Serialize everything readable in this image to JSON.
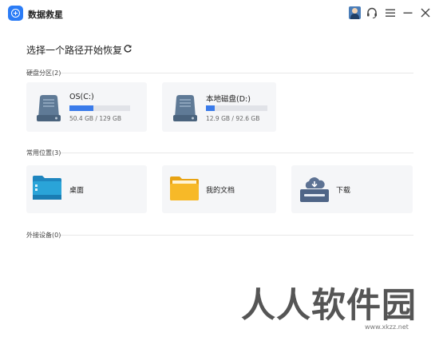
{
  "app": {
    "title": "数据救星"
  },
  "header": {
    "prompt": "选择一个路径开始恢复"
  },
  "groups": {
    "disks_label": "硬盘分区(2)",
    "common_label": "常用位置(3)",
    "external_label": "外接设备(0)"
  },
  "drives": [
    {
      "name": "OS(C:)",
      "size": "50.4 GB / 129 GB",
      "fill": 0.39
    },
    {
      "name": "本地磁盘(D:)",
      "size": "12.9 GB / 92.6 GB",
      "fill": 0.14
    }
  ],
  "locations": [
    {
      "name": "桌面",
      "icon": "desktop-folder-icon"
    },
    {
      "name": "我的文档",
      "icon": "documents-folder-icon"
    },
    {
      "name": "下载",
      "icon": "download-folder-icon"
    }
  ],
  "watermark": {
    "text": "人人软件园",
    "url": "www.xkzz.net"
  },
  "colors": {
    "accent": "#3a7bea",
    "card": "#f5f6f8",
    "folder_yellow": "#f7b928",
    "desktop_blue": "#2aa4d8"
  }
}
